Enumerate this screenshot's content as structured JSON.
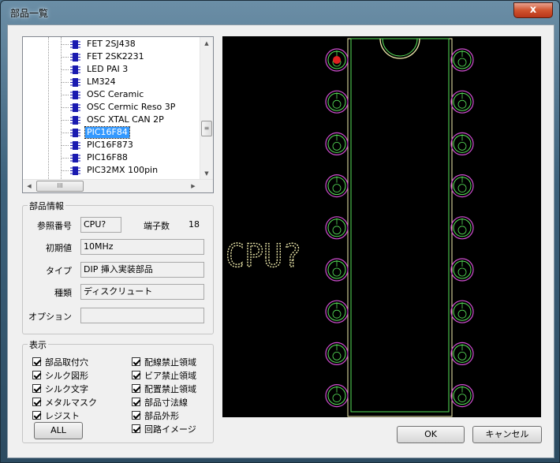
{
  "window": {
    "title": "部品一覧",
    "close_glyph": "x"
  },
  "tree": {
    "items": [
      {
        "label": "FET 2SJ438",
        "selected": false
      },
      {
        "label": "FET 2SK2231",
        "selected": false
      },
      {
        "label": "LED PAI 3",
        "selected": false
      },
      {
        "label": "LM324",
        "selected": false
      },
      {
        "label": "OSC Ceramic",
        "selected": false
      },
      {
        "label": "OSC Cermic Reso 3P",
        "selected": false
      },
      {
        "label": "OSC XTAL CAN 2P",
        "selected": false
      },
      {
        "label": "PIC16F84",
        "selected": true
      },
      {
        "label": "PIC16F873",
        "selected": false
      },
      {
        "label": "PIC16F88",
        "selected": false
      },
      {
        "label": "PIC32MX 100pin",
        "selected": false
      }
    ],
    "scroll_thumb_glyph": "≡",
    "hscroll_thumb_glyph": "III"
  },
  "info": {
    "group_label": "部品情報",
    "ref_label": "参照番号",
    "ref_value": "CPU?",
    "pins_label": "端子数",
    "pins_value": "18",
    "initial_label": "初期値",
    "initial_value": "10MHz",
    "type_label": "タイプ",
    "type_value": "DIP 挿入実装部品",
    "kind_label": "種類",
    "kind_value": "ディスクリュート",
    "option_label": "オプション",
    "option_value": ""
  },
  "display": {
    "group_label": "表示",
    "left": [
      "部品取付穴",
      "シルク図形",
      "シルク文字",
      "メタルマスク",
      "レジスト"
    ],
    "right": [
      "配線禁止領域",
      "ビア禁止領域",
      "配置禁止領域",
      "部品寸法線",
      "部品外形",
      "回路イメージ"
    ],
    "all_button": "ALL"
  },
  "preview": {
    "ref_text": "CPU?",
    "pin_count": 18
  },
  "buttons": {
    "ok": "OK",
    "cancel": "キャンセル"
  },
  "colors": {
    "silk": "#f5f0b0",
    "pad_ring": "#d24fd2",
    "pad_green": "#58e35a",
    "pin1": "#e02020",
    "selection": "#3399ff"
  }
}
